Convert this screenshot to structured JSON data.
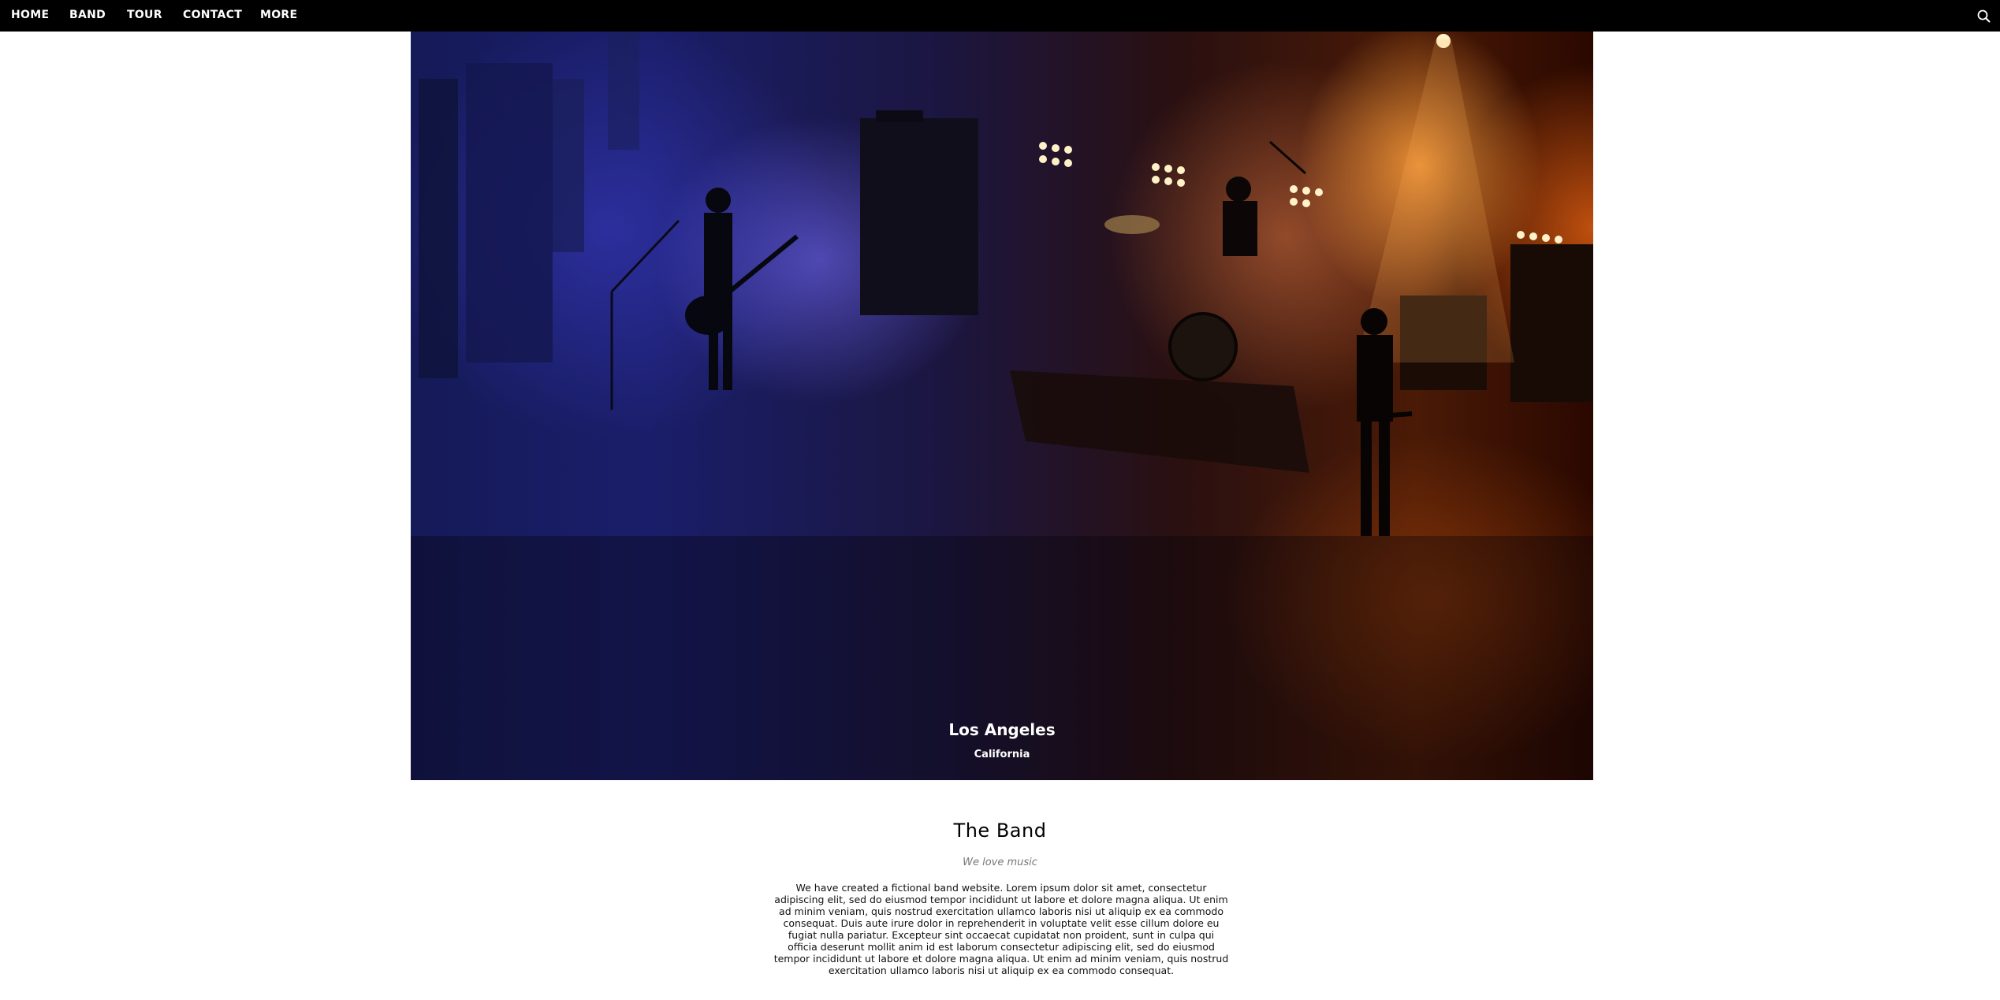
{
  "nav": {
    "items": [
      "HOME",
      "BAND",
      "TOUR",
      "CONTACT",
      "MORE"
    ],
    "search_icon": "search-icon"
  },
  "hero": {
    "title": "Los Angeles",
    "subtitle": "California"
  },
  "band": {
    "title": "The Band",
    "tagline": "We love music",
    "body": "We have created a fictional band website. Lorem ipsum dolor sit amet, consectetur adipiscing elit, sed do eiusmod tempor incididunt ut labore et dolore magna aliqua. Ut enim ad minim veniam, quis nostrud exercitation ullamco laboris nisi ut aliquip ex ea commodo consequat. Duis aute irure dolor in reprehenderit in voluptate velit esse cillum dolore eu fugiat nulla pariatur. Excepteur sint occaecat cupidatat non proident, sunt in culpa qui officia deserunt mollit anim id est laborum consectetur adipiscing elit, sed do eiusmod tempor incididunt ut labore et dolore magna aliqua. Ut enim ad minim veniam, quis nostrud exercitation ullamco laboris nisi ut aliquip ex ea commodo consequat."
  },
  "colors": {
    "nav_bg": "#000000",
    "nav_text": "#ffffff",
    "tagline": "#777777"
  }
}
